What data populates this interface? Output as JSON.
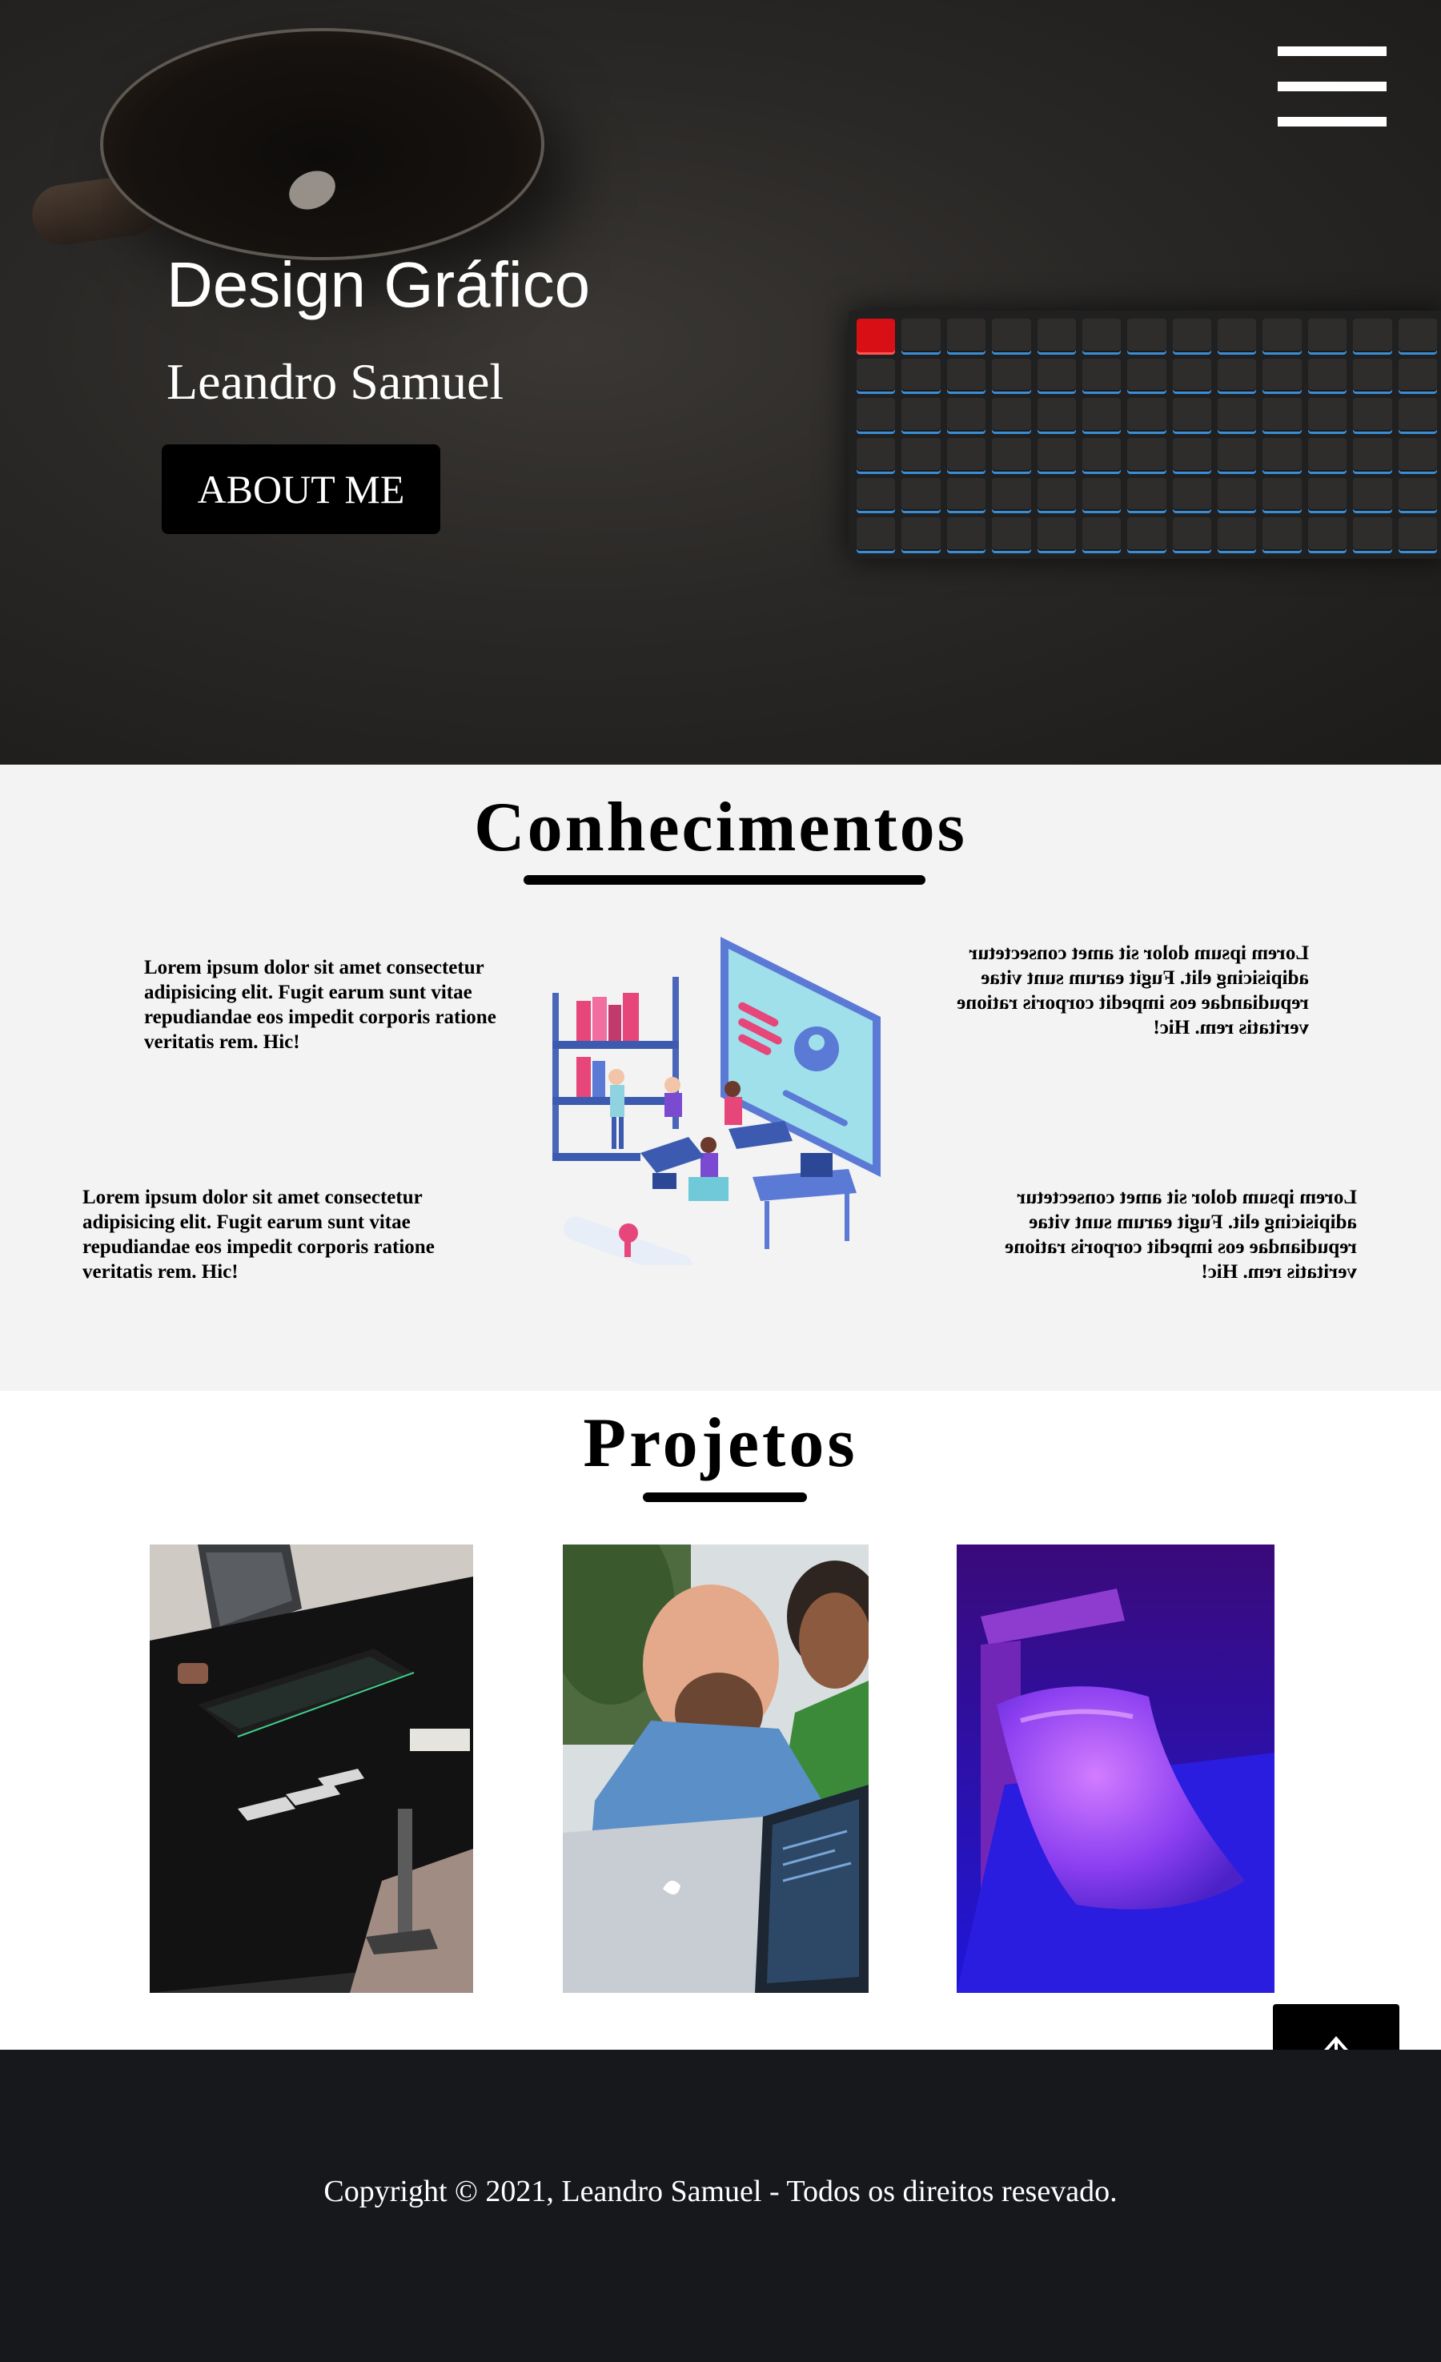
{
  "hero": {
    "title": "Design Gráfico",
    "subtitle": "Leandro Samuel",
    "about_button": "ABOUT ME",
    "menu_icon": "hamburger-menu-icon"
  },
  "knowledge": {
    "title": "Conhecimentos",
    "paragraphs": [
      "Lorem ipsum dolor sit amet consectetur adipisicing elit. Fugit earum sunt vitae repudiandae eos impedit corporis ratione veritatis rem. Hic!",
      "Lorem ipsum dolor sit amet consectetur adipisicing elit. Fugit earum sunt vitae repudiandae eos impedit corporis ratione veritatis rem. Hic!",
      "Lorem ipsum dolor sit amet consectetur adipisicing elit. Fugit earum sunt vitae repudiandae eos impedit corporis ratione veritatis rem. Hic!",
      "Lorem ipsum dolor sit amet consectetur adipisicing elit. Fugit earum sunt vitae repudiandae eos impedit corporis ratione veritatis rem. Hic!"
    ]
  },
  "projects": {
    "title": "Projetos"
  },
  "scroll_top": {
    "icon": "arrow-up-icon"
  },
  "footer": {
    "copyright": "Copyright © 2021, Leandro Samuel - Todos os direitos resevado."
  },
  "colors": {
    "hero_bg": "#2a2826",
    "section_bg": "#f3f3f3",
    "footer_bg": "#17181c",
    "accent_black": "#000000",
    "keyboard_backlight": "#3b8ed6",
    "escape_key": "#d80f14"
  }
}
